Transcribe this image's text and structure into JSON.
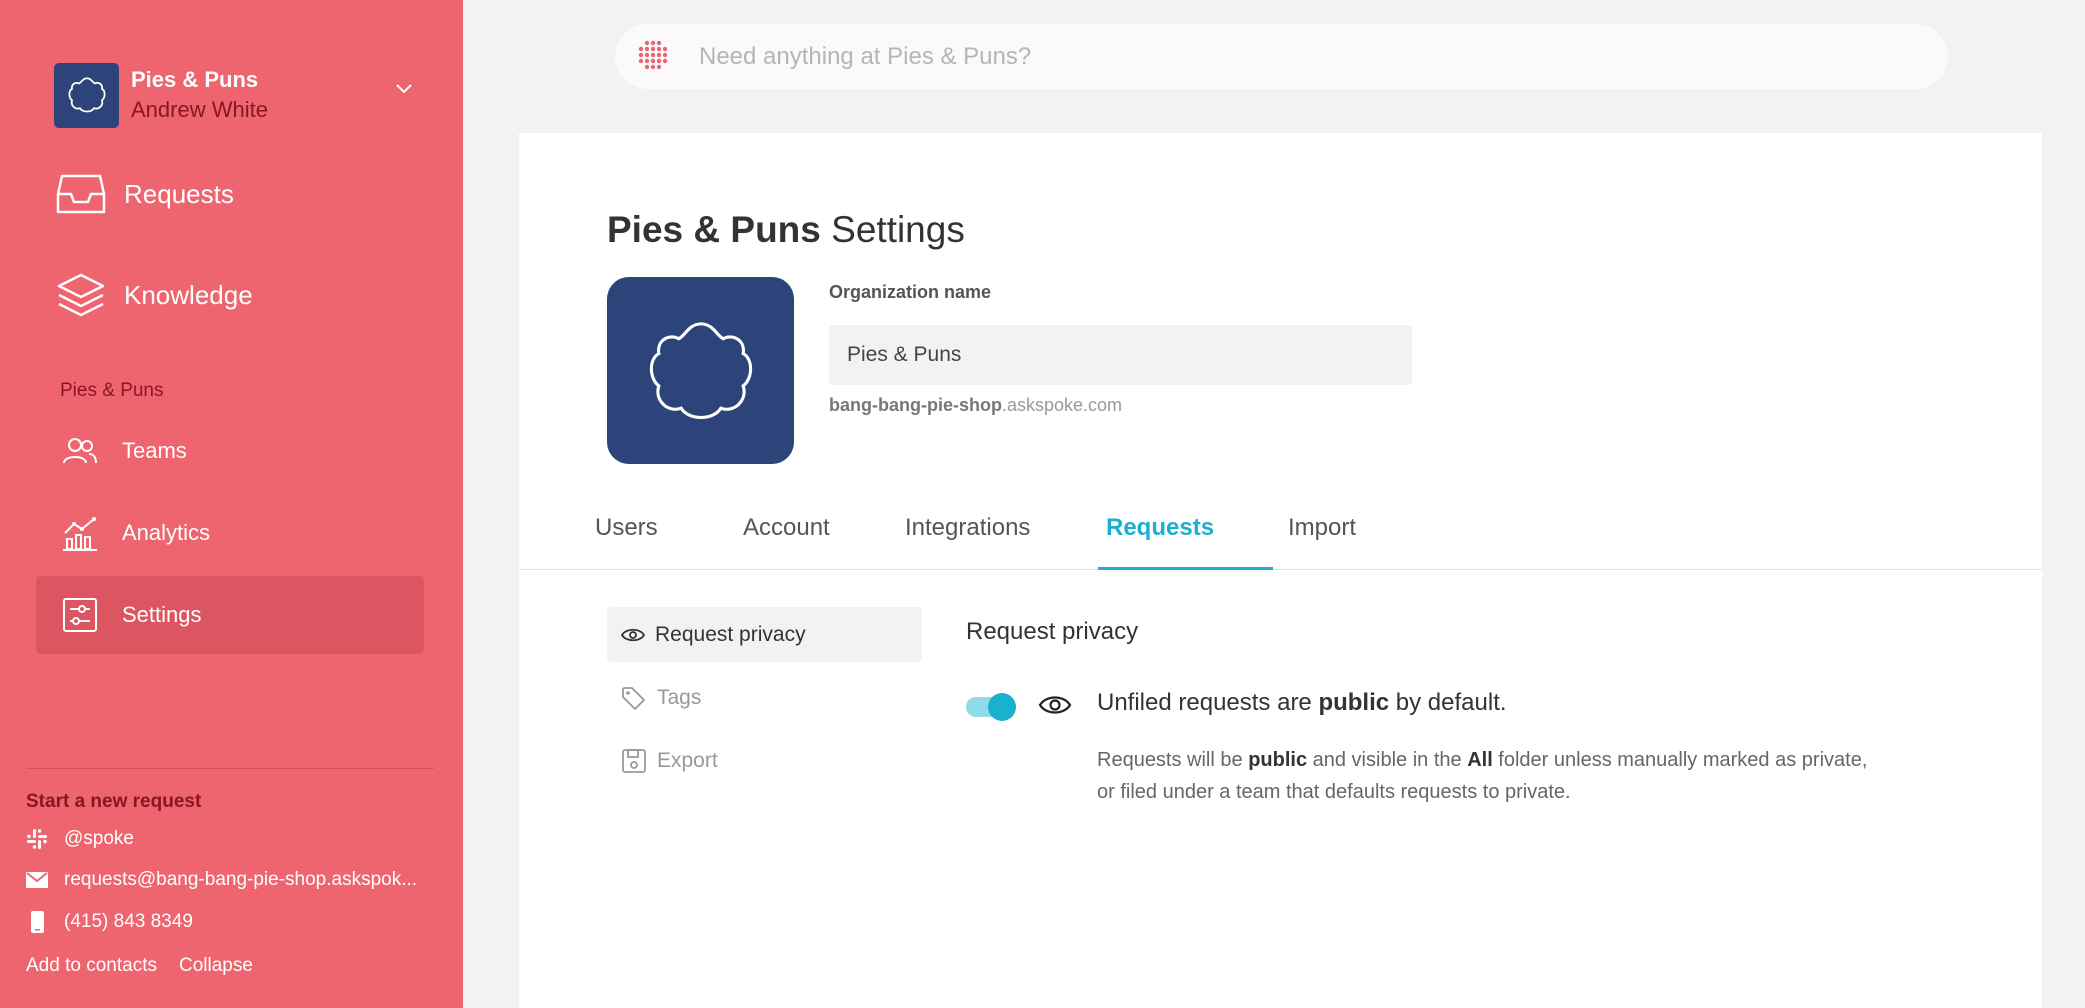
{
  "sidebar": {
    "org_name": "Pies & Puns",
    "user_name": "Andrew White",
    "nav_primary": [
      {
        "label": "Requests",
        "icon": "inbox-icon"
      },
      {
        "label": "Knowledge",
        "icon": "layers-icon"
      }
    ],
    "section_label": "Pies & Puns",
    "nav_secondary": [
      {
        "label": "Teams",
        "icon": "people-icon"
      },
      {
        "label": "Analytics",
        "icon": "chart-icon"
      },
      {
        "label": "Settings",
        "icon": "sliders-icon",
        "active": true
      }
    ],
    "start_request_label": "Start a new request",
    "contacts": {
      "slack": "@spoke",
      "email": "requests@bang-bang-pie-shop.askspok...",
      "phone": "(415) 843 8349"
    },
    "footer": {
      "add_to_contacts": "Add to contacts",
      "collapse": "Collapse"
    }
  },
  "search": {
    "placeholder": "Need anything at Pies & Puns?"
  },
  "settings": {
    "title_org": "Pies & Puns",
    "title_suffix": "Settings",
    "org_name_label": "Organization name",
    "org_name_value": "Pies & Puns",
    "subdomain_bold": "bang-bang-pie-shop",
    "subdomain_suffix": ".askspoke.com",
    "tabs": [
      "Users",
      "Account",
      "Integrations",
      "Requests",
      "Import"
    ],
    "active_tab": "Requests",
    "subnav": [
      {
        "label": "Request privacy",
        "icon": "eye-icon",
        "active": true
      },
      {
        "label": "Tags",
        "icon": "tag-icon"
      },
      {
        "label": "Export",
        "icon": "save-icon"
      }
    ],
    "section_title": "Request privacy",
    "toggle_on": true,
    "privacy_heading": {
      "pre": "Unfiled requests are ",
      "bold": "public",
      "post": " by default."
    },
    "privacy_desc": {
      "p1": "Requests will be ",
      "b1": "public",
      "p2": " and visible in the ",
      "b2": "All",
      "p3": " folder unless manually marked as private, or filed under a team that defaults requests to private."
    }
  },
  "colors": {
    "sidebar_bg": "#ee6570",
    "sidebar_accent_text": "#8a1623",
    "brand_navy": "#2c4479",
    "accent_teal": "#1ab0cf"
  }
}
